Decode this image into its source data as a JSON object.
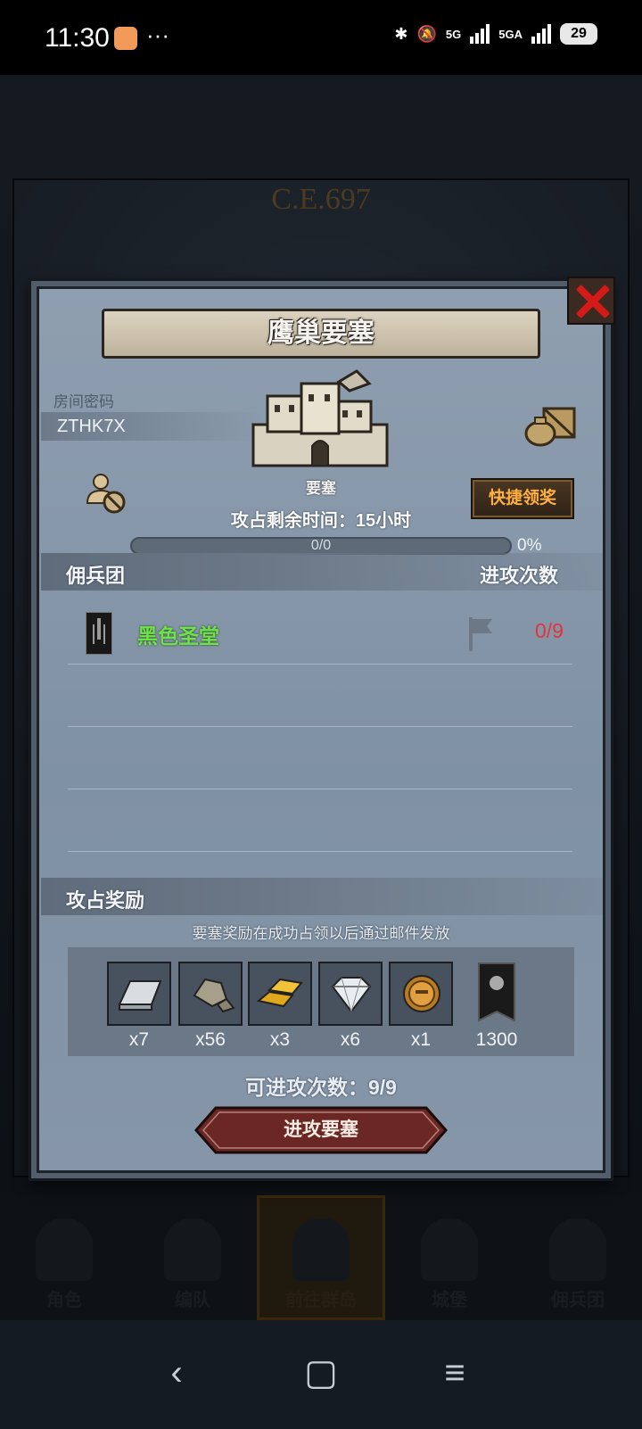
{
  "status_bar": {
    "time": "11:30",
    "more": "···",
    "net1": "5G",
    "net2": "5GA",
    "battery": "29"
  },
  "background": {
    "era": "C.E.697"
  },
  "modal": {
    "title": "鹰巢要塞",
    "room_code_label": "房间密码",
    "room_code": "ZTHK7X",
    "fortress_label": "要塞",
    "quick_claim": "快捷领奖",
    "remaining_label": "攻占剩余时间：",
    "remaining_value": "15小时",
    "progress": {
      "text": "0/0",
      "percent_label": "0%",
      "fraction": 0
    },
    "mercenary_header": "佣兵团",
    "attack_count_header": "进攻次数",
    "guilds": [
      {
        "name": "黑色圣堂",
        "attacks": "0/9"
      }
    ],
    "rewards_header": "攻占奖励",
    "rewards_hint": "要塞奖励在成功占领以后通过邮件发放",
    "rewards": [
      {
        "icon": "silver-ingot-icon",
        "qty": "x7"
      },
      {
        "icon": "stone-ore-icon",
        "qty": "x56"
      },
      {
        "icon": "gold-bars-icon",
        "qty": "x3"
      },
      {
        "icon": "diamond-icon",
        "qty": "x6"
      },
      {
        "icon": "knight-medal-icon",
        "qty": "x1"
      },
      {
        "icon": "guild-banner-icon",
        "qty": "1300"
      }
    ],
    "available_attacks_label": "可进攻次数：",
    "available_attacks_value": "9/9",
    "attack_button": "进攻要塞"
  },
  "bottom_nav": [
    {
      "label": "角色",
      "active": false
    },
    {
      "label": "编队",
      "active": false
    },
    {
      "label": "前往群岛",
      "active": true
    },
    {
      "label": "城堡",
      "active": false
    },
    {
      "label": "佣兵团",
      "active": false
    }
  ],
  "colors": {
    "accent_orange": "#ffb040",
    "guild_green": "#6ee24a",
    "attack_red": "#e1353a",
    "close_red": "#d41b17"
  }
}
